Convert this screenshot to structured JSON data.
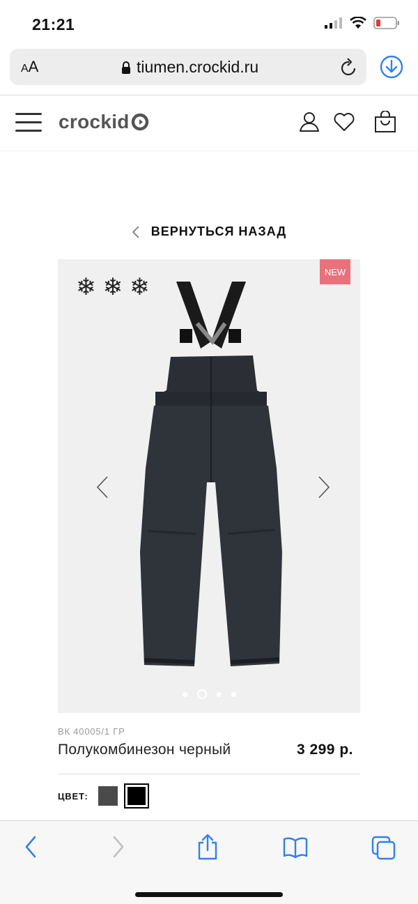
{
  "status": {
    "time": "21:21"
  },
  "browser": {
    "aa_label_small": "A",
    "aa_label": "A",
    "url": "tiumen.crockid.ru"
  },
  "site": {
    "logo": "crockid"
  },
  "back": {
    "label": "ВЕРНУТЬСЯ НАЗАД"
  },
  "product": {
    "badge": "NEW",
    "snowflakes": [
      "❄",
      "❄",
      "❄"
    ],
    "carousel": {
      "total": 4,
      "active_index": 1
    },
    "sku": "ВК 40005/1 ГР",
    "name": "Полукомбинезон черный",
    "price": "3 299 р.",
    "color_label": "ЦВЕТ:",
    "colors": [
      "#4a4a4a",
      "#000000"
    ]
  },
  "colors": {
    "accent": "#2f80ed",
    "badge": "#e8727c"
  }
}
